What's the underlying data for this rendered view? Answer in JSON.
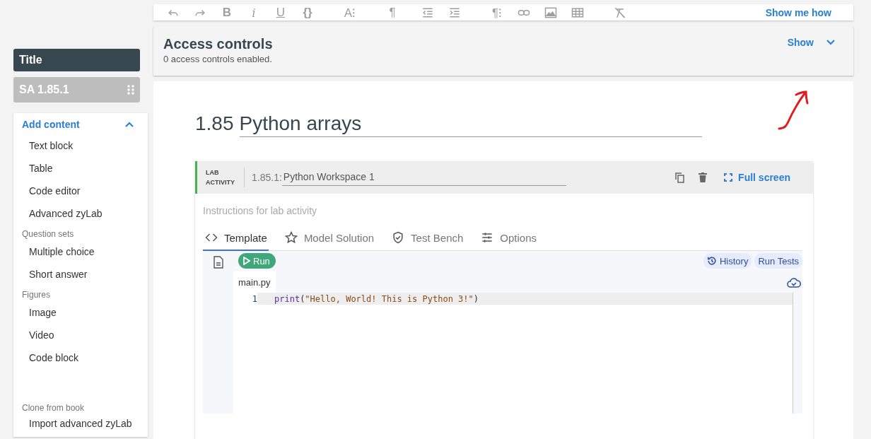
{
  "toolbar": {
    "tools": [
      {
        "kind": "undo"
      },
      {
        "kind": "redo"
      },
      {
        "kind": "bold",
        "label": "B"
      },
      {
        "kind": "italic",
        "label": "i"
      },
      {
        "kind": "underline",
        "label": "U"
      },
      {
        "kind": "code",
        "label": "{}"
      },
      {
        "kind": "font-size",
        "label": "A⁝"
      },
      {
        "kind": "paragraph",
        "label": "¶"
      },
      {
        "kind": "outdent"
      },
      {
        "kind": "indent"
      },
      {
        "kind": "paragraph-settings",
        "label": "¶⁝"
      },
      {
        "kind": "link"
      },
      {
        "kind": "image"
      },
      {
        "kind": "table"
      },
      {
        "kind": "clear-format"
      }
    ],
    "help": "Show me how"
  },
  "sidebar": {
    "title": "Title",
    "section_label": "SA 1.85.1",
    "add_content": {
      "label": "Add content",
      "expanded": true,
      "groups": [
        {
          "items": [
            "Text block",
            "Table",
            "Code editor",
            "Advanced zyLab"
          ]
        },
        {
          "heading": "Question sets",
          "items": [
            "Multiple choice",
            "Short answer"
          ]
        },
        {
          "heading": "Figures",
          "items": [
            "Image",
            "Video",
            "Code block"
          ]
        },
        {
          "heading": "Clone from book",
          "items": [
            "Import advanced zyLab"
          ]
        }
      ]
    }
  },
  "access_controls": {
    "title": "Access controls",
    "summary": "0 access controls enabled.",
    "toggle": "Show",
    "expanded": false
  },
  "section": {
    "number": "1.85",
    "title": "Python arrays"
  },
  "lab": {
    "type_label": "LAB ACTIVITY",
    "number": "1.85.1:",
    "title": "Python Workspace 1",
    "full_screen": "Full screen",
    "instructions_placeholder": "Instructions for lab activity",
    "tabs": [
      {
        "kind": "code",
        "label": "Template",
        "selected": true
      },
      {
        "kind": "star",
        "label": "Model Solution",
        "selected": false
      },
      {
        "kind": "shield",
        "label": "Test Bench",
        "selected": false
      },
      {
        "kind": "sliders",
        "label": "Options",
        "selected": false
      }
    ],
    "run": "Run",
    "history": "History",
    "run_tests": "Run Tests",
    "file": "main.py",
    "code": [
      {
        "number": "1",
        "tokens": [
          {
            "kind": "builtin",
            "text": "print"
          },
          {
            "kind": "punct",
            "text": "("
          },
          {
            "kind": "string",
            "text": "\"Hello, World! This is Python 3!\""
          },
          {
            "kind": "punct",
            "text": ")"
          }
        ]
      }
    ]
  }
}
